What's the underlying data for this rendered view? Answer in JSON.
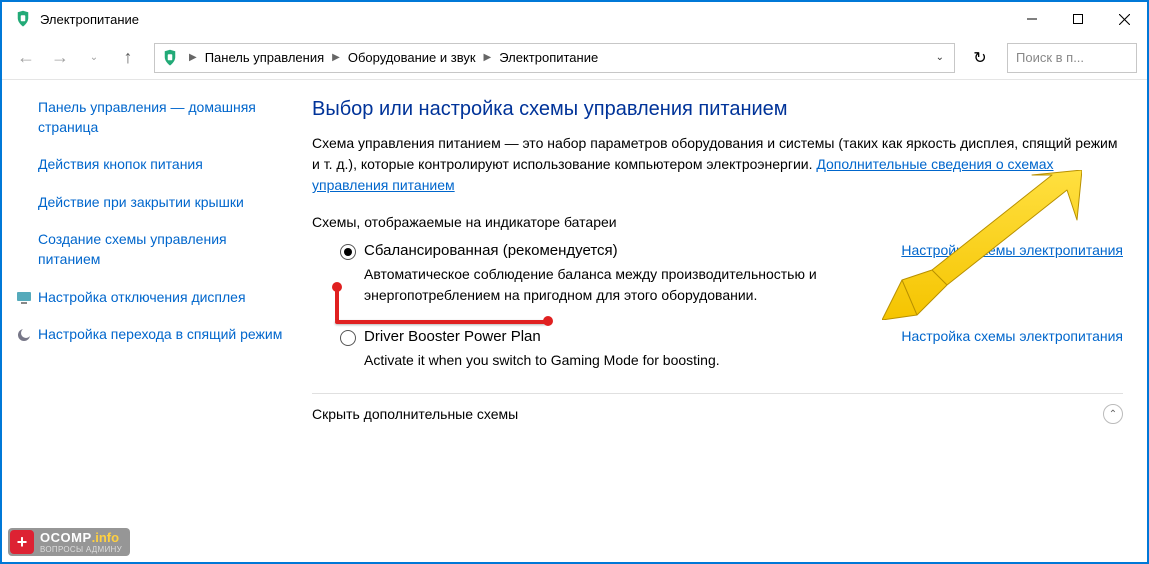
{
  "window": {
    "title": "Электропитание"
  },
  "breadcrumb": {
    "items": [
      "Панель управления",
      "Оборудование и звук",
      "Электропитание"
    ]
  },
  "search": {
    "placeholder": "Поиск в п..."
  },
  "sidebar": {
    "home": "Панель управления — домашняя страница",
    "links": [
      "Действия кнопок питания",
      "Действие при закрытии крышки",
      "Создание схемы управления питанием"
    ],
    "icon_links": [
      "Настройка отключения дисплея",
      "Настройка перехода в спящий режим"
    ]
  },
  "main": {
    "title": "Выбор или настройка схемы управления питанием",
    "description": "Схема управления питанием — это набор параметров оборудования и системы (таких как яркость дисплея, спящий режим и т. д.), которые контролируют использование компьютером электроэнергии. ",
    "more_link": "Дополнительные сведения о схемах управления питанием",
    "section_header": "Схемы, отображаемые на индикаторе батареи",
    "plans": [
      {
        "name": "Сбалансированная (рекомендуется)",
        "selected": true,
        "link": "Настройка схемы электропитания",
        "desc": "Автоматическое соблюдение баланса между производительностью и энергопотреблением на пригодном для этого оборудовании."
      },
      {
        "name": "Driver Booster Power Plan",
        "selected": false,
        "link": "Настройка схемы электропитания",
        "desc": "Activate it when you switch to Gaming Mode for boosting."
      }
    ],
    "hide_label": "Скрыть дополнительные схемы"
  },
  "watermark": {
    "main": "OCOMP",
    "info": ".info",
    "sub": "ВОПРОСЫ АДМИНУ"
  }
}
